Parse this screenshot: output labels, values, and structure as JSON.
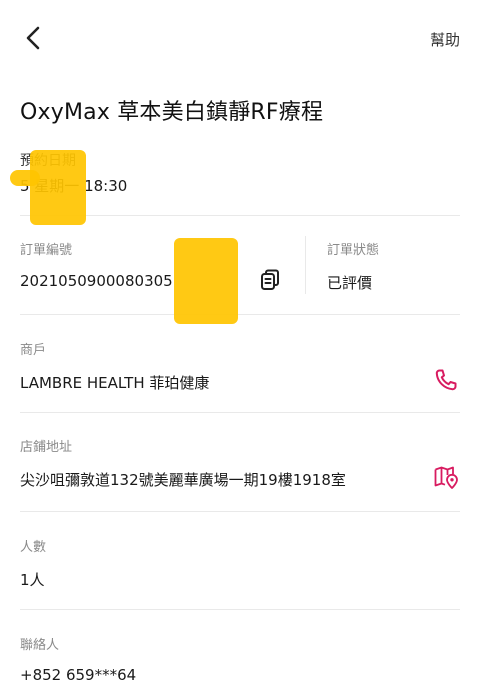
{
  "header": {
    "back_icon": "chevron-left-icon",
    "help_label": "幫助"
  },
  "title": "OxyMax 草本美白鎮靜RF療程",
  "booking": {
    "label": "預約日期",
    "value": "5 星期一 18:30"
  },
  "order": {
    "number_label": "訂單編號",
    "number_value": "2021050900080305",
    "copy_icon": "copy-icon",
    "status_label": "訂單狀態",
    "status_value": "已評價"
  },
  "merchant": {
    "label": "商戶",
    "value": "LAMBRE HEALTH 菲珀健康",
    "phone_icon": "phone-icon"
  },
  "address": {
    "label": "店鋪地址",
    "value": "尖沙咀彌敦道132號美麗華廣場一期19樓1918室",
    "map_icon": "map-pin-icon"
  },
  "people": {
    "label": "人數",
    "value": "1人"
  },
  "contact": {
    "label": "聯絡人",
    "value": "+852 659***64"
  },
  "colors": {
    "accent": "#d81b60",
    "redaction": "#ffc400",
    "divider": "#e9e9e9",
    "label": "#8a8a8a"
  }
}
